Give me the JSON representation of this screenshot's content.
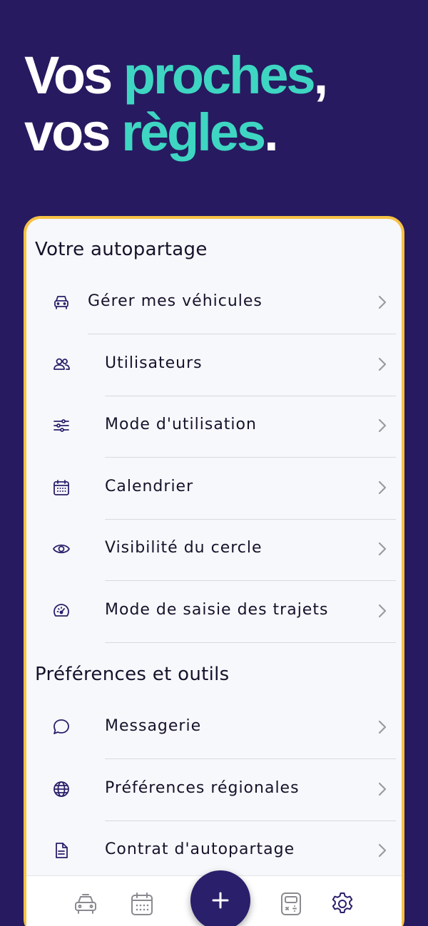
{
  "hero": {
    "line1_word1": "Vos ",
    "line1_accent": "proches",
    "line1_punct": ",",
    "line2_word1": "vos ",
    "line2_accent": "règles",
    "line2_punct": "."
  },
  "colors": {
    "background": "#271a60",
    "accent": "#3ed6c2",
    "card_border": "#f7c244",
    "icon": "#2a1f6b"
  },
  "sections": [
    {
      "title": "Votre autopartage",
      "items": [
        {
          "label": "Gérer mes véhicules",
          "icon": "car-icon"
        },
        {
          "label": "Utilisateurs",
          "icon": "users-icon"
        },
        {
          "label": "Mode d'utilisation",
          "icon": "sliders-icon"
        },
        {
          "label": "Calendrier",
          "icon": "calendar-icon"
        },
        {
          "label": "Visibilité du cercle",
          "icon": "eye-icon"
        },
        {
          "label": "Mode de saisie des trajets",
          "icon": "speedometer-icon"
        }
      ]
    },
    {
      "title": "Préférences et outils",
      "items": [
        {
          "label": "Messagerie",
          "icon": "chat-icon"
        },
        {
          "label": "Préférences régionales",
          "icon": "globe-icon"
        },
        {
          "label": "Contrat d'autopartage",
          "icon": "document-icon"
        }
      ]
    }
  ],
  "tabbar": {
    "tabs": [
      {
        "icon": "car-icon"
      },
      {
        "icon": "calendar-icon"
      },
      {
        "icon": "plus-icon"
      },
      {
        "icon": "calculator-icon"
      },
      {
        "icon": "gear-icon"
      }
    ]
  }
}
